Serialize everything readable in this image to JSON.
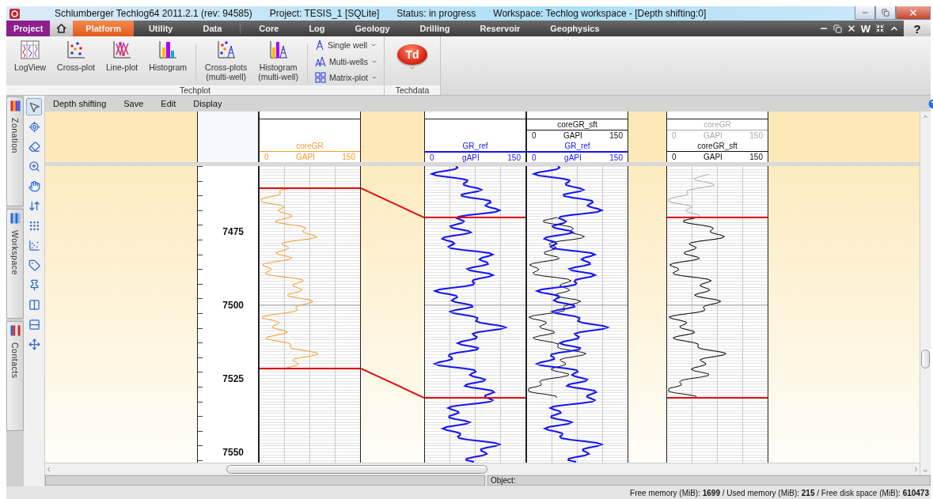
{
  "title_bar": {
    "texts": [
      "Schlumberger Techlog64 2011.2.1 (rev: 94585)",
      "Project: TESIS_1 [SQLite]",
      "Status: in progress",
      "Workspace: Techlog workspace - [Depth shifting:0]"
    ]
  },
  "menu_tabs": [
    {
      "kind": "project",
      "label": "Project",
      "selected": false
    },
    {
      "kind": "home",
      "selected": false
    },
    {
      "kind": "tab",
      "label": "Platform",
      "selected": true
    },
    {
      "kind": "tab",
      "label": "Utility",
      "selected": false
    },
    {
      "kind": "tab",
      "label": "Data",
      "selected": false
    },
    {
      "kind": "tab",
      "label": "Core",
      "selected": false,
      "separator_before": true
    },
    {
      "kind": "tab",
      "label": "Log",
      "selected": false
    },
    {
      "kind": "tab",
      "label": "Geology",
      "selected": false
    },
    {
      "kind": "tab",
      "label": "Drilling",
      "selected": false
    },
    {
      "kind": "tab",
      "label": "Reservoir",
      "selected": false
    },
    {
      "kind": "tab",
      "label": "Geophysics",
      "selected": false
    }
  ],
  "menu_tools": [
    {
      "kind": "minimize"
    },
    {
      "kind": "restore"
    },
    {
      "kind": "close"
    },
    {
      "kind": "text",
      "label": "W"
    },
    {
      "kind": "collapse"
    },
    {
      "kind": "up"
    },
    {
      "kind": "help",
      "label": "?"
    }
  ],
  "ribbon": {
    "groups": [
      {
        "label": "Techplot",
        "large": [
          {
            "kind": "logview",
            "label": "LogView"
          },
          {
            "kind": "crossplot",
            "label": "Cross-plot"
          },
          {
            "kind": "lineplot",
            "label": "Line-plot"
          },
          {
            "kind": "histogram",
            "label": "Histogram",
            "separator_after": true
          },
          {
            "kind": "crossplot-multi",
            "label": "Cross-plots\n(multi-well)"
          },
          {
            "kind": "histogram-multi",
            "label": "Histogram\n(multi-well)",
            "separator_after": true
          }
        ],
        "small": [
          {
            "kind": "single-well",
            "label": "Single well"
          },
          {
            "kind": "multi-wells",
            "label": "Multi-wells"
          },
          {
            "kind": "matrix",
            "label": "Matrix-plot"
          }
        ]
      },
      {
        "label": "Techdata",
        "large": [
          {
            "kind": "td",
            "label": "Td"
          }
        ]
      }
    ]
  },
  "side_tabs": [
    {
      "kind": "zonation",
      "label": "Zonation"
    },
    {
      "kind": "workspace",
      "label": "Workspace"
    },
    {
      "kind": "contacts",
      "label": "Contacts"
    }
  ],
  "tools": [
    {
      "kind": "pointer",
      "selected": true
    },
    {
      "kind": "target",
      "selected": false
    },
    {
      "kind": "eraser",
      "selected": false
    },
    {
      "kind": "zoom",
      "selected": false
    },
    {
      "kind": "hand",
      "selected": false
    },
    {
      "kind": "sort",
      "selected": false
    },
    {
      "kind": "scatter",
      "selected": false
    },
    {
      "kind": "grid",
      "selected": false
    },
    {
      "kind": "tag",
      "selected": false
    },
    {
      "kind": "pin",
      "selected": false
    },
    {
      "kind": "vsplit",
      "selected": false
    },
    {
      "kind": "hsplit",
      "selected": false
    },
    {
      "kind": "move",
      "selected": false
    }
  ],
  "doc_menu": [
    "Depth shifting",
    "Save",
    "Edit",
    "Display"
  ],
  "depth_labels": [
    "7475",
    "7500",
    "7525",
    "7550"
  ],
  "tracks": [
    {
      "kind": "fill"
    },
    {
      "kind": "depth"
    },
    {
      "kind": "log",
      "curves": [
        {
          "name": "coreGR",
          "min": "0",
          "unit": "GAPI",
          "max": "150",
          "color": "#f39a2b"
        }
      ]
    },
    {
      "kind": "gap"
    },
    {
      "kind": "log",
      "curves": [
        {
          "name": "GR_ref",
          "min": "0",
          "unit": "gAPI",
          "max": "150",
          "color": "#1414f0"
        }
      ]
    },
    {
      "kind": "log",
      "curves": [
        {
          "name": "coreGR_sft",
          "min": "0",
          "unit": "GAPI",
          "max": "150",
          "color": "#111111"
        },
        {
          "name": "GR_ref",
          "min": "0",
          "unit": "gAPI",
          "max": "150",
          "color": "#1414f0"
        }
      ]
    },
    {
      "kind": "gap"
    },
    {
      "kind": "log",
      "curves": [
        {
          "name": "coreGR",
          "min": "0",
          "unit": "GAPI",
          "max": "150",
          "color": "#aaaaaa"
        },
        {
          "name": "coreGR_sft",
          "min": "0",
          "unit": "GAPI",
          "max": "150",
          "color": "#111111"
        }
      ]
    },
    {
      "kind": "fill"
    }
  ],
  "object_bar": {
    "label": "Object:"
  },
  "status": "Free memory (MiB): **1699** / Used memory (MiB): **215** / Free disk space (MiB): **610473**"
}
